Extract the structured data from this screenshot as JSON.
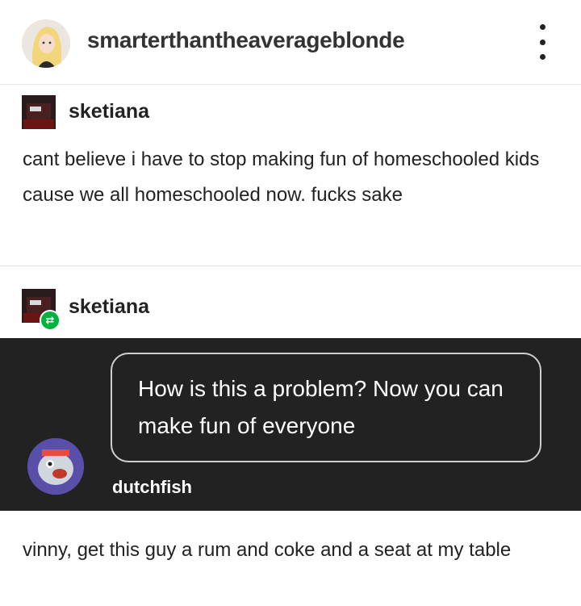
{
  "header": {
    "blog_name": "smarterthantheaverageblonde",
    "more_icon": "more-vertical-icon"
  },
  "post1": {
    "author": "sketiana",
    "text": "cant believe i have to stop making fun of homeschooled kids cause we all homeschooled now. fucks sake"
  },
  "post2": {
    "author": "sketiana",
    "badge_icon": "reblog-icon"
  },
  "quote": {
    "text": "How is this a problem? Now you can make fun of everyone",
    "author": "dutchfish"
  },
  "post3": {
    "text": "vinny, get this guy a rum and coke and a seat at my table"
  },
  "colors": {
    "dark_panel": "#222222",
    "reblog_green": "#00b33c"
  }
}
